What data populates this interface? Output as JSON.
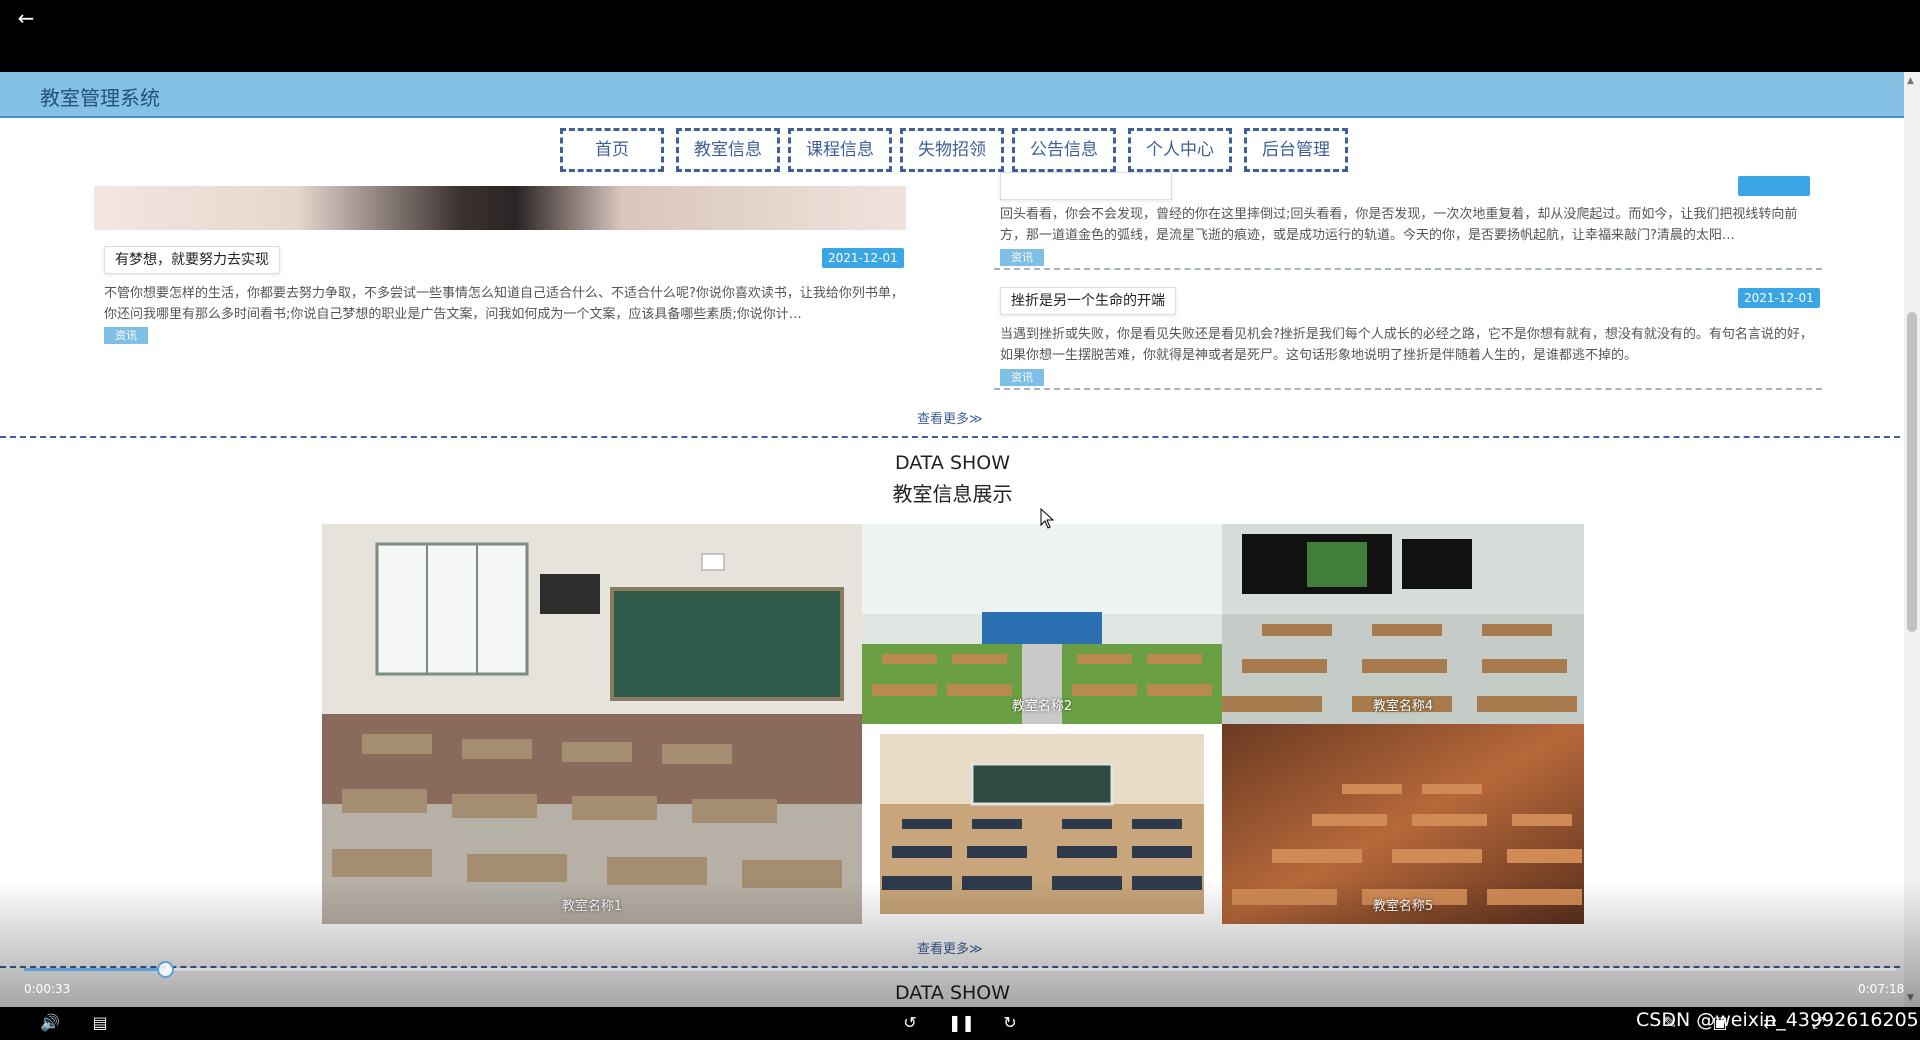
{
  "site": {
    "title": "教室管理系统"
  },
  "nav": [
    "首页",
    "教室信息",
    "课程信息",
    "失物招领",
    "公告信息",
    "个人中心",
    "后台管理"
  ],
  "news": [
    {
      "title": "有梦想，就要努力去实现",
      "date": "2021-12-01",
      "body": "不管你想要怎样的生活，你都要去努力争取，不多尝试一些事情怎么知道自己适合什么、不适合什么呢?你说你喜欢读书，让我给你列书单，你还问我哪里有那么多时间看书;你说自己梦想的职业是广告文案，问我如何成为一个文案，应该具备哪些素质;你说你计…",
      "tag": "资讯"
    },
    {
      "title": "",
      "date": "",
      "body": "回头看看，你会不会发现，曾经的你在这里摔倒过;回头看看，你是否发现，一次次地重复着，却从没爬起过。而如今，让我们把视线转向前方，那一道道金色的弧线，是流星飞逝的痕迹，或是成功运行的轨道。今天的你，是否要扬帆起航，让幸福来敲门?清晨的太阳…",
      "tag": "资讯"
    },
    {
      "title": "挫折是另一个生命的开端",
      "date": "2021-12-01",
      "body": "当遇到挫折或失败，你是看见失败还是看见机会?挫折是我们每个人成长的必经之路，它不是你想有就有，想没有就没有的。有句名言说的好，如果你想一生摆脱苦难，你就得是神或者是死尸。这句话形象地说明了挫折是伴随着人生的，是谁都逃不掉的。",
      "tag": "资讯"
    }
  ],
  "news_more": "查看更多≫",
  "data_show": {
    "en": "DATA SHOW",
    "cn": "教室信息展示",
    "more": "查看更多≫",
    "next_en": "DATA SHOW"
  },
  "gallery": [
    {
      "caption": "教室名称1"
    },
    {
      "caption": "教室名称2"
    },
    {
      "caption": "教室名称4"
    },
    {
      "caption": ""
    },
    {
      "caption": "教室名称5"
    }
  ],
  "video": {
    "current_time": "0:00:33",
    "total_time": "0:07:18",
    "progress": 0.0753,
    "watermark": "CSDN @weixin_43992616205"
  },
  "colors": {
    "header_bg": "#85c1e5",
    "nav_border": "#3e5f9a",
    "date_badge": "#3aa6e6",
    "tag_bg": "#7dbfe5"
  }
}
